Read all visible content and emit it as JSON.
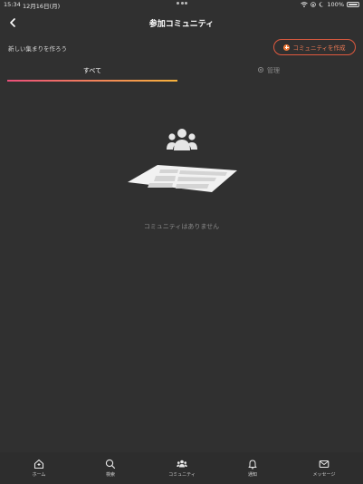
{
  "status_bar": {
    "time": "15:34",
    "date": "12月16日(月)",
    "battery": "100%"
  },
  "header": {
    "title": "参加コミュニティ"
  },
  "subheader": {
    "text": "新しい集まりを作ろう",
    "create_button_label": "コミュニティを作成"
  },
  "tabs": [
    {
      "label": "すべて",
      "active": true
    },
    {
      "label": "管理",
      "active": false
    }
  ],
  "empty_state": {
    "message": "コミュニティはありません"
  },
  "bottom_nav": {
    "items": [
      {
        "label": "ホーム",
        "icon": "home-icon"
      },
      {
        "label": "検索",
        "icon": "search-icon"
      },
      {
        "label": "コミュニティ",
        "icon": "community-icon"
      },
      {
        "label": "通知",
        "icon": "bell-icon"
      },
      {
        "label": "メッセージ",
        "icon": "mail-icon"
      }
    ]
  },
  "colors": {
    "background": "#303030",
    "accent": "#ee7a55",
    "tab_gradient_start": "#ea4f7a",
    "tab_gradient_end": "#f6b23c"
  }
}
